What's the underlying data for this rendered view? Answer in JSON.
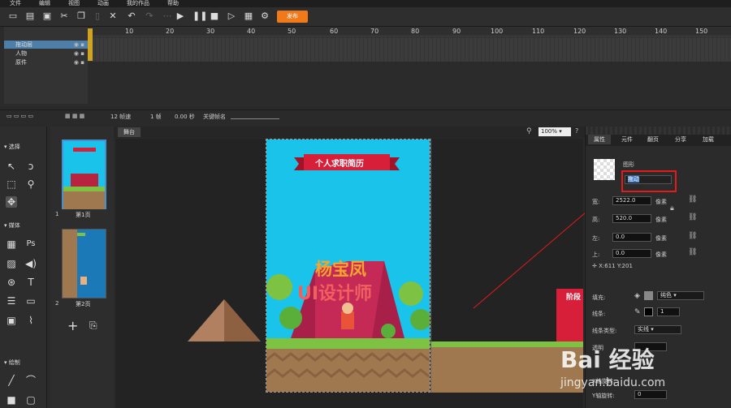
{
  "menu": [
    "文件",
    "编辑",
    "视图",
    "动画",
    "我的作品",
    "帮助"
  ],
  "toolbar": {
    "publish": "发布"
  },
  "layers": [
    {
      "name": "拖动层",
      "selected": true
    },
    {
      "name": "人物",
      "selected": false
    },
    {
      "name": "原件",
      "selected": false
    }
  ],
  "ruler": [
    "10",
    "20",
    "30",
    "40",
    "50",
    "60",
    "70",
    "80",
    "90",
    "100",
    "110",
    "120",
    "130",
    "140",
    "150"
  ],
  "timeline_status": {
    "fps": "12 帧速",
    "frame": "1 帧",
    "time": "0.00 秒",
    "keyframe_label": "关键帧名"
  },
  "left": {
    "select_section": "选择",
    "media_section": "媒体",
    "draw_section": "绘制",
    "ps_label": "Ps"
  },
  "pages": [
    {
      "num": "1",
      "label": "第1页"
    },
    {
      "num": "2",
      "label": "第2页"
    }
  ],
  "stage": {
    "tab": "舞台",
    "zoom": "100%"
  },
  "canvas": {
    "banner": "个人求职简历",
    "name": "杨宝凤",
    "title": "UI设计师",
    "right_sign": "阶段"
  },
  "props": {
    "tabs": [
      "属性",
      "元件",
      "翻页",
      "分享",
      "加载"
    ],
    "type_label": "图形",
    "name_value": "拖动",
    "width_label": "宽:",
    "width_value": "2522.0",
    "height_label": "高:",
    "height_value": "520.0",
    "left_label": "左:",
    "left_value": "0.0",
    "top_label": "上:",
    "top_value": "0.0",
    "unit": "像素",
    "coord": "X:611   Y:201",
    "fill_label": "填充:",
    "fill_value": "纯色",
    "stroke_label": "线条:",
    "stroke_value": "1",
    "stroke_type_label": "线条类型:",
    "stroke_type_value": "实线",
    "opacity_label": "透明",
    "x_rot_label": "X轴旋转:",
    "y_rot_label": "Y轴旋转:",
    "y_rot_value": "0"
  },
  "watermark": {
    "brand": "Bai 经验",
    "url": "jingyan.baidu.com"
  },
  "colors": {
    "accent": "#f07a1a",
    "highlight_box": "#e21b1b",
    "sky": "#19c3ea",
    "grass": "#7dc243",
    "dirt": "#a07850"
  }
}
